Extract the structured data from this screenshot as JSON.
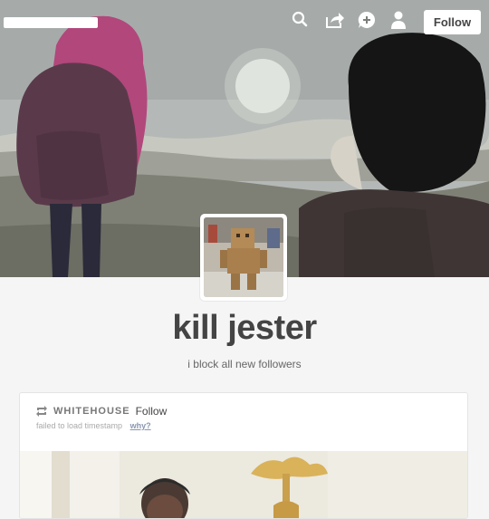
{
  "header": {
    "follow_label": "Follow",
    "icons": [
      "search-icon",
      "share-icon",
      "add-icon",
      "user-icon"
    ]
  },
  "profile": {
    "title": "kill jester",
    "description": "i block all new followers"
  },
  "post": {
    "reblog_user": "WHITEHOUSE",
    "follow_label": "Follow",
    "meta_text": "failed to load timestamp",
    "why_link": "why?"
  },
  "colors": {
    "page_background": "#f5f5f5",
    "follow_button": "#ffffff",
    "title_text": "#444444",
    "link_muted": "#8a97b0"
  }
}
